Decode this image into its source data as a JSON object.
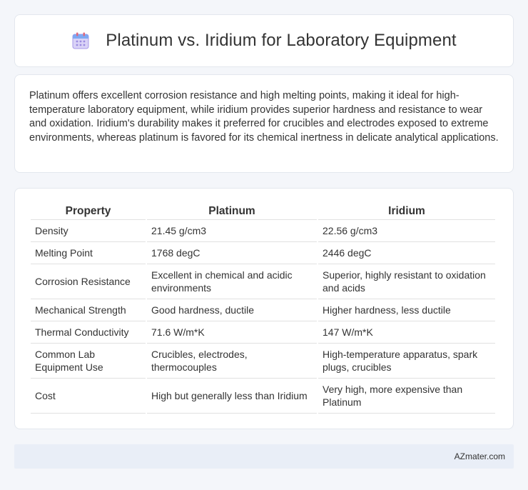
{
  "header": {
    "title": "Platinum vs. Iridium for Laboratory Equipment",
    "icon": "calendar-icon"
  },
  "description": "Platinum offers excellent corrosion resistance and high melting points, making it ideal for high-temperature laboratory equipment, while iridium provides superior hardness and resistance to wear and oxidation. Iridium's durability makes it preferred for crucibles and electrodes exposed to extreme environments, whereas platinum is favored for its chemical inertness in delicate analytical applications.",
  "table": {
    "headers": [
      "Property",
      "Platinum",
      "Iridium"
    ],
    "rows": [
      [
        "Density",
        "21.45 g/cm3",
        "22.56 g/cm3"
      ],
      [
        "Melting Point",
        "1768 degC",
        "2446 degC"
      ],
      [
        "Corrosion Resistance",
        "Excellent in chemical and acidic environments",
        "Superior, highly resistant to oxidation and acids"
      ],
      [
        "Mechanical Strength",
        "Good hardness, ductile",
        "Higher hardness, less ductile"
      ],
      [
        "Thermal Conductivity",
        "71.6 W/m*K",
        "147 W/m*K"
      ],
      [
        "Common Lab Equipment Use",
        "Crucibles, electrodes, thermocouples",
        "High-temperature apparatus, spark plugs, crucibles"
      ],
      [
        "Cost",
        "High but generally less than Iridium",
        "Very high, more expensive than Platinum"
      ]
    ]
  },
  "footer": {
    "brand": "AZmater.com"
  }
}
